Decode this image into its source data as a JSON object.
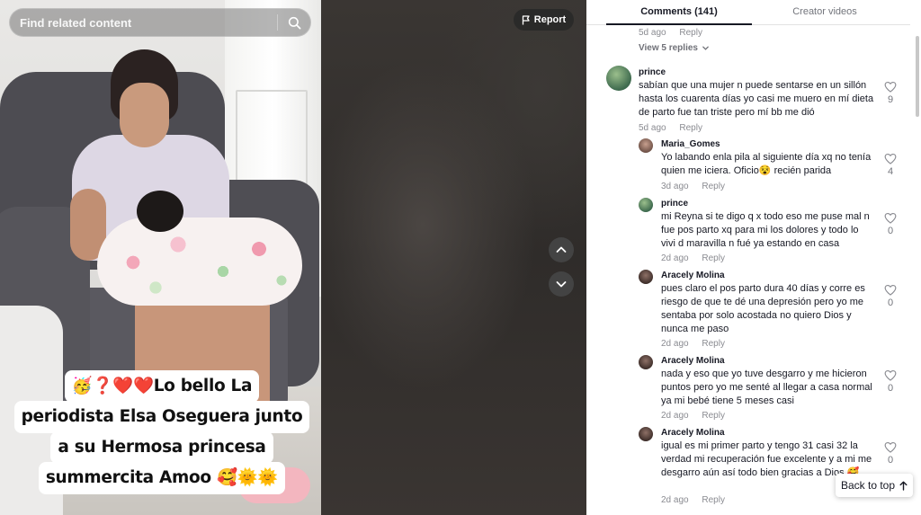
{
  "search": {
    "placeholder": "Find related content"
  },
  "video": {
    "report_label": "Report",
    "caption_lines": [
      "🥳❓❤️❤️Lo bello La",
      "periodista Elsa Oseguera junto",
      "a su Hermosa princesa",
      "summercita Amoo 🥰🌞🌞"
    ]
  },
  "tabs": {
    "comments": "Comments (141)",
    "creator": "Creator videos"
  },
  "top_meta": {
    "time": "5d ago",
    "reply": "Reply",
    "view_replies": "View 5 replies"
  },
  "comments": [
    {
      "user": "prince",
      "text": "sabían que una mujer n puede sentarse en un sillón hasta los cuarenta días yo casi me muero en mí dieta de parto fue tan triste pero mí bb me dió",
      "time": "5d ago",
      "reply": "Reply",
      "likes": "9"
    },
    {
      "user": "Maria_Gomes",
      "text": "Yo labando enla pila al siguiente día xq no tenía quien me iciera. Oficio😵 recién parida",
      "time": "3d ago",
      "reply": "Reply",
      "likes": "4"
    },
    {
      "user": "prince",
      "text": "mi Reyna si te digo q x todo eso me puse mal n fue pos parto xq para mi los dolores y todo lo vivi d maravilla n fué ya estando en casa",
      "time": "2d ago",
      "reply": "Reply",
      "likes": "0"
    },
    {
      "user": "Aracely Molina",
      "text": "pues claro el pos parto dura 40 días y corre es riesgo de que te dé una depresión pero yo me sentaba por solo acostada no quiero Dios y nunca me paso",
      "time": "2d ago",
      "reply": "Reply",
      "likes": "0"
    },
    {
      "user": "Aracely Molina",
      "text": "nada y eso que yo tuve desgarro y me hicieron puntos pero yo me senté al llegar a casa normal ya mi bebé tiene 5 meses casi",
      "time": "2d ago",
      "reply": "Reply",
      "likes": "0"
    },
    {
      "user": "Aracely Molina",
      "text": "igual es mi primer parto y tengo 31 casi 32 la verdad mi recuperación fue excelente y a mi me desgarro aún así todo bien gracias a Dios 🥰",
      "time": "2d ago",
      "reply": "Reply",
      "likes": "0"
    }
  ],
  "back_to_top": "Back to top",
  "colors": {
    "text": "#161823",
    "muted": "#8a8b91",
    "panel_bg": "#ffffff"
  }
}
